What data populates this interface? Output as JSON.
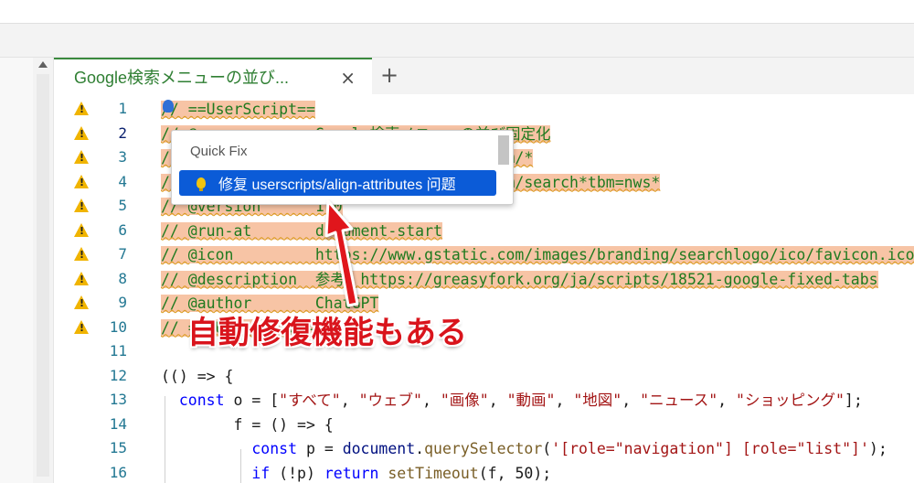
{
  "tab": {
    "title": "Google検索メニューの並び...",
    "close_glyph": "×",
    "add_glyph": "+"
  },
  "quick_fix": {
    "title": "Quick Fix",
    "item_label": "修复 userscripts/align-attributes 问题"
  },
  "annotation": {
    "callout_text": "自動修復機能もある"
  },
  "colors": {
    "accent_green": "#2f7f33",
    "selection": "#0b5bd7",
    "highlight": "#f7c4a5",
    "warning": "#f0b400",
    "callout_red": "#d9141c"
  },
  "lines": [
    {
      "num": "1",
      "warn": true,
      "text": "// ==UserScript=="
    },
    {
      "num": "2",
      "warn": true,
      "text": "// @name         Google検索メニューの並び固定化",
      "active": true
    },
    {
      "num": "3",
      "warn": true,
      "text": "// @match        https://www.google.com/*"
    },
    {
      "num": "4",
      "warn": true,
      "text": "// @exclude      https://www.google.com/search*tbm=nws*"
    },
    {
      "num": "5",
      "warn": true,
      "text": "// @version      1.0"
    },
    {
      "num": "6",
      "warn": true,
      "text": "// @run-at       document-start"
    },
    {
      "num": "7",
      "warn": true,
      "text": "// @icon         https://www.gstatic.com/images/branding/searchlogo/ico/favicon.ico"
    },
    {
      "num": "8",
      "warn": true,
      "text": "// @description  参考：https://greasyfork.org/ja/scripts/18521-google-fixed-tabs"
    },
    {
      "num": "9",
      "warn": true,
      "text": "// @author       ChatGPT"
    },
    {
      "num": "10",
      "warn": true,
      "text": "// ==/UserScript=="
    },
    {
      "num": "11",
      "warn": false,
      "text": ""
    },
    {
      "num": "12",
      "warn": false,
      "text": "(() => {"
    },
    {
      "num": "13",
      "warn": false,
      "text": "  const o = [\"すべて\", \"ウェブ\", \"画像\", \"動画\", \"地図\", \"ニュース\", \"ショッピング\"];"
    },
    {
      "num": "14",
      "warn": false,
      "text": "        f = () => {"
    },
    {
      "num": "15",
      "warn": false,
      "text": "          const p = document.querySelector('[role=\"navigation\"] [role=\"list\"]');"
    },
    {
      "num": "16",
      "warn": false,
      "text": "          if (!p) return setTimeout(f, 50);"
    }
  ]
}
